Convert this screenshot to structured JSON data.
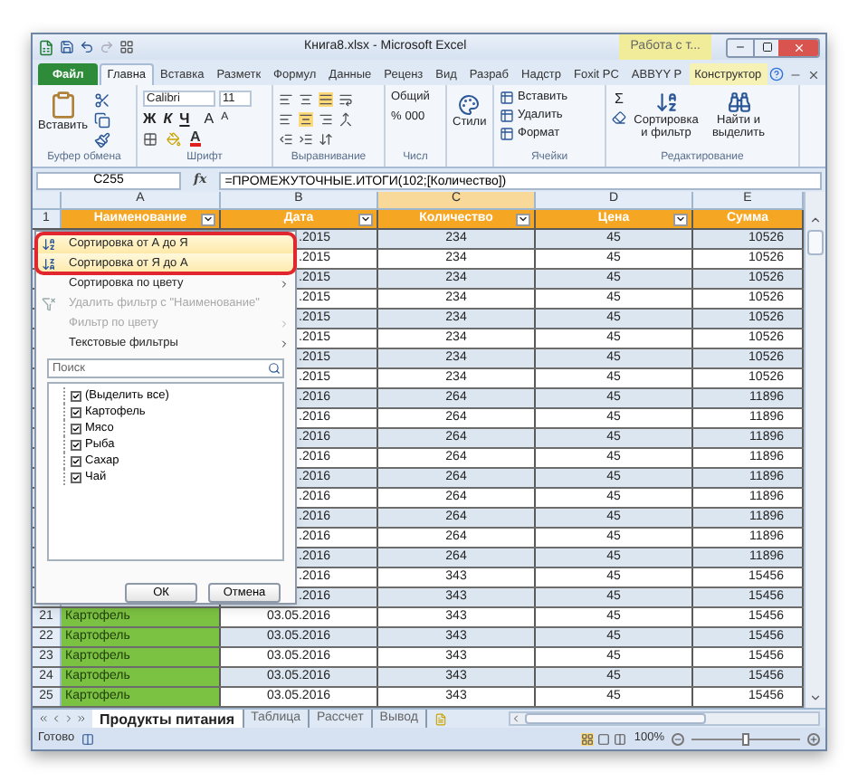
{
  "window": {
    "title": "Книга8.xlsx - Microsoft Excel",
    "context_tab": "Работа с т..."
  },
  "ribbon_tabs": [
    {
      "label": "Файл",
      "kind": "file",
      "selected": false
    },
    {
      "label": "Главна",
      "kind": "tab",
      "selected": true
    },
    {
      "label": "Вставка",
      "kind": "tab",
      "selected": false
    },
    {
      "label": "Разметк",
      "kind": "tab",
      "selected": false
    },
    {
      "label": "Формул",
      "kind": "tab",
      "selected": false
    },
    {
      "label": "Данные",
      "kind": "tab",
      "selected": false
    },
    {
      "label": "Реценз",
      "kind": "tab",
      "selected": false
    },
    {
      "label": "Вид",
      "kind": "tab",
      "selected": false
    },
    {
      "label": "Разраб",
      "kind": "tab",
      "selected": false
    },
    {
      "label": "Надстр",
      "kind": "tab",
      "selected": false
    },
    {
      "label": "Foxit PC",
      "kind": "tab",
      "selected": false
    },
    {
      "label": "ABBYY P",
      "kind": "tab",
      "selected": false
    },
    {
      "label": "Конструктор",
      "kind": "context",
      "selected": false
    }
  ],
  "ribbon": {
    "clipboard": {
      "paste": "Вставить",
      "label": "Буфер обмена"
    },
    "font": {
      "name": "Calibri",
      "size": "11",
      "bold": "Ж",
      "italic": "К",
      "underline": "Ч",
      "grow": "A",
      "shrink": "A",
      "font_color": "A",
      "label": "Шрифт"
    },
    "alignment": {
      "label": "Выравнивание"
    },
    "number": {
      "format": "Общий",
      "percent": "%",
      "thousands": "000",
      "label": "Числ"
    },
    "styles": {
      "button": "Стили"
    },
    "cells": {
      "items": [
        "Вставить",
        "Удалить",
        "Формат"
      ],
      "label": "Ячейки"
    },
    "editing": {
      "sum": "Σ",
      "sort": "Сортировка и фильтр",
      "find": "Найти и выделить",
      "label": "Редактирование"
    }
  },
  "formula_bar": {
    "cell": "C255",
    "function_label": "fx",
    "formula": "=ПРОМЕЖУТОЧНЫЕ.ИТОГИ(102;[Количество])"
  },
  "columns": [
    {
      "label": "A",
      "selected": false
    },
    {
      "label": "B",
      "selected": false
    },
    {
      "label": "C",
      "selected": true
    },
    {
      "label": "D",
      "selected": false
    },
    {
      "label": "E",
      "selected": false
    }
  ],
  "header_row": {
    "number": "1",
    "cells": [
      {
        "label": "Наименование",
        "filter": true
      },
      {
        "label": "Дата",
        "filter": true
      },
      {
        "label": "Количество",
        "filter": true
      },
      {
        "label": "Цена",
        "filter": true
      },
      {
        "label": "Сумма",
        "filter": false
      }
    ]
  },
  "rows": [
    {
      "b": ".2015",
      "c": "234",
      "d": "45",
      "e": "10526"
    },
    {
      "b": ".2015",
      "c": "234",
      "d": "45",
      "e": "10526"
    },
    {
      "b": ".2015",
      "c": "234",
      "d": "45",
      "e": "10526"
    },
    {
      "b": ".2015",
      "c": "234",
      "d": "45",
      "e": "10526"
    },
    {
      "b": ".2015",
      "c": "234",
      "d": "45",
      "e": "10526"
    },
    {
      "b": ".2015",
      "c": "234",
      "d": "45",
      "e": "10526"
    },
    {
      "b": ".2015",
      "c": "234",
      "d": "45",
      "e": "10526"
    },
    {
      "b": ".2015",
      "c": "234",
      "d": "45",
      "e": "10526"
    },
    {
      "b": ".2016",
      "c": "264",
      "d": "45",
      "e": "11896"
    },
    {
      "b": ".2016",
      "c": "264",
      "d": "45",
      "e": "11896"
    },
    {
      "b": ".2016",
      "c": "264",
      "d": "45",
      "e": "11896"
    },
    {
      "b": ".2016",
      "c": "264",
      "d": "45",
      "e": "11896"
    },
    {
      "b": ".2016",
      "c": "264",
      "d": "45",
      "e": "11896"
    },
    {
      "b": ".2016",
      "c": "264",
      "d": "45",
      "e": "11896"
    },
    {
      "b": ".2016",
      "c": "264",
      "d": "45",
      "e": "11896"
    },
    {
      "b": ".2016",
      "c": "264",
      "d": "45",
      "e": "11896"
    },
    {
      "b": ".2016",
      "c": "264",
      "d": "45",
      "e": "11896"
    },
    {
      "b": ".2016",
      "c": "343",
      "d": "45",
      "e": "15456"
    },
    {
      "b": ".2016",
      "c": "343",
      "d": "45",
      "e": "15456"
    },
    {
      "number": "21",
      "a": "Картофель",
      "b": "03.05.2016",
      "c": "343",
      "d": "45",
      "e": "15456"
    },
    {
      "number": "22",
      "a": "Картофель",
      "b": "03.05.2016",
      "c": "343",
      "d": "45",
      "e": "15456"
    },
    {
      "number": "23",
      "a": "Картофель",
      "b": "03.05.2016",
      "c": "343",
      "d": "45",
      "e": "15456"
    },
    {
      "number": "24",
      "a": "Картофель",
      "b": "03.05.2016",
      "c": "343",
      "d": "45",
      "e": "15456"
    },
    {
      "number": "25",
      "a": "Картофель",
      "b": "03.05.2016",
      "c": "343",
      "d": "45",
      "e": "15456"
    }
  ],
  "filter_menu": {
    "items": [
      {
        "label": "Сортировка от А до Я",
        "kind": "sort_asc",
        "highlighted": true,
        "disabled": false,
        "submenu": false
      },
      {
        "label": "Сортировка от Я до А",
        "kind": "sort_desc",
        "highlighted": true,
        "disabled": false,
        "submenu": false
      },
      {
        "label": "Сортировка по цвету",
        "kind": "plain",
        "highlighted": false,
        "disabled": false,
        "submenu": true
      },
      {
        "label": "Удалить фильтр с \"Наименование\"",
        "kind": "clear",
        "highlighted": false,
        "disabled": true,
        "submenu": false
      },
      {
        "label": "Фильтр по цвету",
        "kind": "plain",
        "highlighted": false,
        "disabled": true,
        "submenu": true
      },
      {
        "label": "Текстовые фильтры",
        "kind": "plain",
        "highlighted": false,
        "disabled": false,
        "submenu": true
      }
    ],
    "search": {
      "placeholder": "Поиск"
    },
    "values": [
      {
        "label": "(Выделить все)",
        "checked": true
      },
      {
        "label": "Картофель",
        "checked": true
      },
      {
        "label": "Мясо",
        "checked": true
      },
      {
        "label": "Рыба",
        "checked": true
      },
      {
        "label": "Сахар",
        "checked": true
      },
      {
        "label": "Чай",
        "checked": true
      }
    ],
    "buttons": [
      "ОК",
      "Отмена"
    ]
  },
  "sheet_tabs": [
    {
      "label": "Продукты питания",
      "selected": true
    },
    {
      "label": "Таблица",
      "selected": false
    },
    {
      "label": "Рассчет",
      "selected": false
    },
    {
      "label": "Вывод",
      "selected": false
    }
  ],
  "status_bar": {
    "text": "Готово",
    "zoom": "100%",
    "zoom_slider": {
      "level": 0.5
    }
  }
}
